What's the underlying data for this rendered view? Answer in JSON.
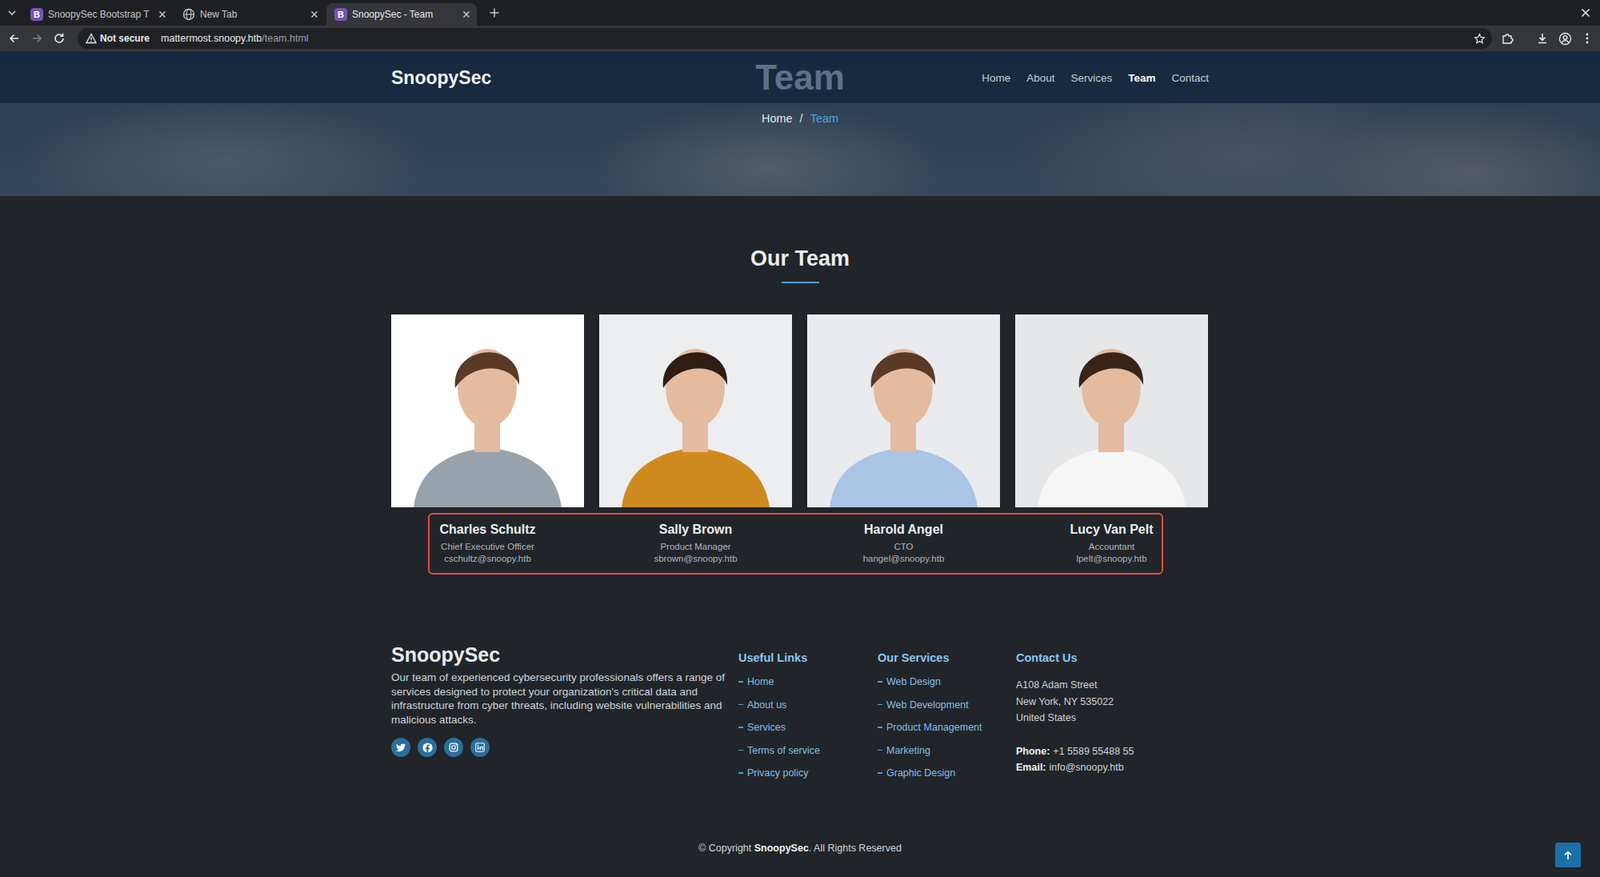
{
  "browser": {
    "tabs": [
      {
        "kind": "site",
        "favicon": "B",
        "label": "SnoopySec Bootstrap T",
        "selected": false
      },
      {
        "kind": "newtab",
        "label": "New Tab",
        "selected": false
      },
      {
        "kind": "site",
        "favicon": "B",
        "label": "SnoopySec - Team",
        "selected": true
      }
    ],
    "security": "Not secure",
    "url_host": "mattermost.snoopy.htb",
    "url_path": "/team.html"
  },
  "site": {
    "brand": "SnoopySec",
    "nav": [
      {
        "label": "Home",
        "selected": false
      },
      {
        "label": "About",
        "selected": false
      },
      {
        "label": "Services",
        "selected": false
      },
      {
        "label": "Team",
        "selected": true
      },
      {
        "label": "Contact",
        "selected": false
      }
    ],
    "hero": {
      "title": "Team",
      "separator": "/",
      "breadcrumb": [
        {
          "label": "Home",
          "selected": false
        },
        {
          "label": "Team",
          "selected": true
        }
      ]
    },
    "team": {
      "title": "Our Team",
      "highlighted": true,
      "members": [
        {
          "name": "Charles Schultz",
          "role": "Chief Executive Officer",
          "email": "cschultz@snoopy.htb"
        },
        {
          "name": "Sally Brown",
          "role": "Product Manager",
          "email": "sbrown@snoopy.htb"
        },
        {
          "name": "Harold Angel",
          "role": "CTO",
          "email": "hangel@snoopy.htb"
        },
        {
          "name": "Lucy Van Pelt",
          "role": "Accountant",
          "email": "lpelt@snoopy.htb"
        }
      ]
    },
    "footer": {
      "brand": "SnoopySec",
      "description": "Our team of experienced cybersecurity professionals offers a range of services designed to protect your organization's critical data and infrastructure from cyber threats, including website vulnerabilities and malicious attacks.",
      "social": [
        {
          "kind": "twitter"
        },
        {
          "kind": "facebook"
        },
        {
          "kind": "instagram"
        },
        {
          "kind": "linkedin"
        }
      ],
      "useful_title": "Useful Links",
      "useful_links": [
        "Home",
        "About us",
        "Services",
        "Terms of service",
        "Privacy policy"
      ],
      "services_title": "Our Services",
      "services": [
        "Web Design",
        "Web Development",
        "Product Management",
        "Marketing",
        "Graphic Design"
      ],
      "contact_title": "Contact Us",
      "address": [
        "A108 Adam Street",
        "New York, NY 535022",
        "United States"
      ],
      "phone_label": "Phone:",
      "phone": "+1 5589 55488 55",
      "email_label": "Email:",
      "email": "info@snoopy.htb"
    },
    "copyright": {
      "prefix": "© Copyright ",
      "brand": "SnoopySec",
      "suffix": ". All Rights Reserved"
    }
  }
}
